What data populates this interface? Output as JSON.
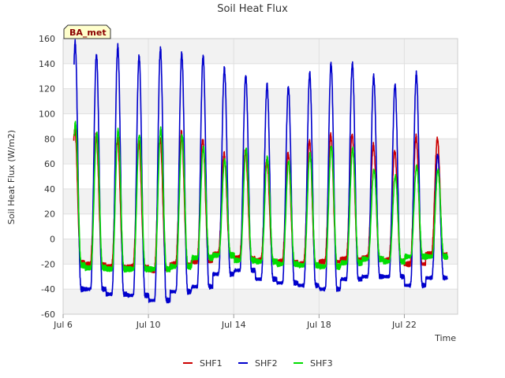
{
  "chart_data": {
    "type": "line",
    "title": "Soil Heat Flux",
    "xlabel": "Time",
    "ylabel": "Soil Heat Flux (W/m2)",
    "badge": "BA_met",
    "ylim": [
      -60,
      160
    ],
    "xlim_days": [
      6.0,
      24.5
    ],
    "yticks": [
      -60,
      -40,
      -20,
      0,
      20,
      40,
      60,
      80,
      100,
      120,
      140,
      160
    ],
    "xticks": [
      {
        "day": 6,
        "label": "Jul 6"
      },
      {
        "day": 10,
        "label": "Jul 10"
      },
      {
        "day": 14,
        "label": "Jul 14"
      },
      {
        "day": 18,
        "label": "Jul 18"
      },
      {
        "day": 22,
        "label": "Jul 22"
      }
    ],
    "grid": true,
    "legend_position": "bottom",
    "start_day": 6.5,
    "series": [
      {
        "name": "SHF1",
        "color": "#cc0000",
        "daily": [
          {
            "day": 6,
            "min": -18,
            "max": 88
          },
          {
            "day": 7,
            "min": -20,
            "max": 83
          },
          {
            "day": 8,
            "min": -22,
            "max": 80
          },
          {
            "day": 9,
            "min": -22,
            "max": 78
          },
          {
            "day": 10,
            "min": -25,
            "max": 80
          },
          {
            "day": 11,
            "min": -20,
            "max": 85
          },
          {
            "day": 12,
            "min": -18,
            "max": 79
          },
          {
            "day": 13,
            "min": -12,
            "max": 68
          },
          {
            "day": 14,
            "min": -15,
            "max": 70
          },
          {
            "day": 15,
            "min": -17,
            "max": 63
          },
          {
            "day": 16,
            "min": -18,
            "max": 68
          },
          {
            "day": 17,
            "min": -20,
            "max": 78
          },
          {
            "day": 18,
            "min": -18,
            "max": 83
          },
          {
            "day": 19,
            "min": -16,
            "max": 83
          },
          {
            "day": 20,
            "min": -15,
            "max": 75
          },
          {
            "day": 21,
            "min": -17,
            "max": 70
          },
          {
            "day": 22,
            "min": -20,
            "max": 82
          },
          {
            "day": 23,
            "min": -12,
            "max": 80
          }
        ]
      },
      {
        "name": "SHF2",
        "color": "#0000cc",
        "daily": [
          {
            "day": 6,
            "min": -40,
            "max": 157
          },
          {
            "day": 7,
            "min": -40,
            "max": 147
          },
          {
            "day": 8,
            "min": -44,
            "max": 154
          },
          {
            "day": 9,
            "min": -45,
            "max": 146
          },
          {
            "day": 10,
            "min": -49,
            "max": 152
          },
          {
            "day": 11,
            "min": -42,
            "max": 148
          },
          {
            "day": 12,
            "min": -38,
            "max": 146
          },
          {
            "day": 13,
            "min": -28,
            "max": 136
          },
          {
            "day": 14,
            "min": -25,
            "max": 130
          },
          {
            "day": 15,
            "min": -32,
            "max": 123
          },
          {
            "day": 16,
            "min": -35,
            "max": 121
          },
          {
            "day": 17,
            "min": -37,
            "max": 132
          },
          {
            "day": 18,
            "min": -40,
            "max": 140
          },
          {
            "day": 19,
            "min": -32,
            "max": 140
          },
          {
            "day": 20,
            "min": -30,
            "max": 130
          },
          {
            "day": 21,
            "min": -30,
            "max": 123
          },
          {
            "day": 22,
            "min": -37,
            "max": 132
          },
          {
            "day": 23,
            "min": -31,
            "max": 67
          }
        ]
      },
      {
        "name": "SHF3",
        "color": "#00dd00",
        "daily": [
          {
            "day": 6,
            "min": -21,
            "max": 93
          },
          {
            "day": 7,
            "min": -23,
            "max": 85
          },
          {
            "day": 8,
            "min": -24,
            "max": 87
          },
          {
            "day": 9,
            "min": -24,
            "max": 83
          },
          {
            "day": 10,
            "min": -24,
            "max": 88
          },
          {
            "day": 11,
            "min": -22,
            "max": 83
          },
          {
            "day": 12,
            "min": -15,
            "max": 73
          },
          {
            "day": 13,
            "min": -13,
            "max": 63
          },
          {
            "day": 14,
            "min": -17,
            "max": 72
          },
          {
            "day": 15,
            "min": -18,
            "max": 65
          },
          {
            "day": 16,
            "min": -20,
            "max": 62
          },
          {
            "day": 17,
            "min": -21,
            "max": 68
          },
          {
            "day": 18,
            "min": -22,
            "max": 74
          },
          {
            "day": 19,
            "min": -19,
            "max": 72
          },
          {
            "day": 20,
            "min": -16,
            "max": 55
          },
          {
            "day": 21,
            "min": -18,
            "max": 50
          },
          {
            "day": 22,
            "min": -14,
            "max": 58
          },
          {
            "day": 23,
            "min": -14,
            "max": 55
          }
        ]
      }
    ]
  }
}
